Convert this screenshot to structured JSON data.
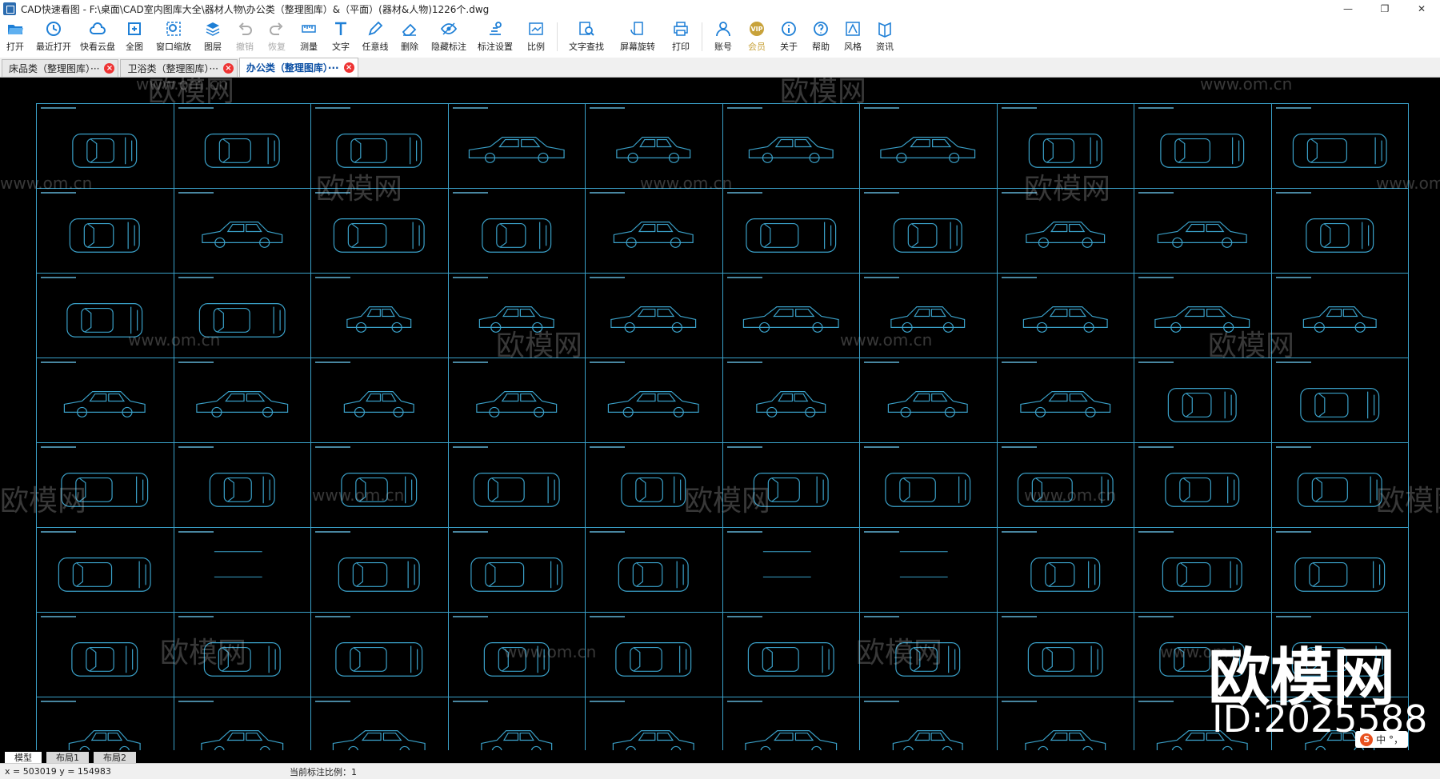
{
  "window": {
    "title": "CAD快速看图 - F:\\桌面\\CAD室内图库大全\\器材人物\\办公类（整理图库）&（平面）(器材&人物)1226个.dwg",
    "controls": {
      "minimize": "—",
      "maximize": "❐",
      "close": "✕"
    }
  },
  "toolbar": [
    {
      "key": "open",
      "label": "打开",
      "icon": "folder-open-icon",
      "color": "#1e7fd6"
    },
    {
      "key": "recent",
      "label": "最近打开",
      "icon": "clock-icon",
      "color": "#1e7fd6"
    },
    {
      "key": "cloud",
      "label": "快看云盘",
      "icon": "cloud-icon",
      "color": "#1e7fd6"
    },
    {
      "key": "fullview",
      "label": "全图",
      "icon": "fullview-icon",
      "color": "#1e7fd6"
    },
    {
      "key": "zoomwin",
      "label": "窗口缩放",
      "icon": "zoom-window-icon",
      "color": "#1e7fd6"
    },
    {
      "key": "layers",
      "label": "图层",
      "icon": "layers-icon",
      "color": "#1e7fd6"
    },
    {
      "key": "undo",
      "label": "撤销",
      "icon": "undo-icon",
      "color": "#aaaaaa",
      "disabled": true
    },
    {
      "key": "redo",
      "label": "恢复",
      "icon": "redo-icon",
      "color": "#aaaaaa",
      "disabled": true
    },
    {
      "key": "measure",
      "label": "测量",
      "icon": "ruler-icon",
      "color": "#1e7fd6"
    },
    {
      "key": "text",
      "label": "文字",
      "icon": "text-icon",
      "color": "#1e7fd6"
    },
    {
      "key": "freeline",
      "label": "任意线",
      "icon": "pen-icon",
      "color": "#1e7fd6"
    },
    {
      "key": "delete",
      "label": "删除",
      "icon": "eraser-icon",
      "color": "#1e7fd6"
    },
    {
      "key": "hidemark",
      "label": "隐藏标注",
      "icon": "eye-icon",
      "color": "#1e7fd6"
    },
    {
      "key": "marksettings",
      "label": "标注设置",
      "icon": "settings-icon",
      "color": "#1e7fd6"
    },
    {
      "key": "ratio",
      "label": "比例",
      "icon": "scale-icon",
      "color": "#1e7fd6"
    },
    {
      "key": "findtext",
      "label": "文字查找",
      "icon": "find-icon",
      "color": "#1e7fd6"
    },
    {
      "key": "rotate",
      "label": "屏幕旋转",
      "icon": "rotate-icon",
      "color": "#1e7fd6"
    },
    {
      "key": "print",
      "label": "打印",
      "icon": "printer-icon",
      "color": "#1e7fd6"
    },
    {
      "key": "account",
      "label": "账号",
      "icon": "user-icon",
      "color": "#1e7fd6"
    },
    {
      "key": "vip",
      "label": "会员",
      "icon": "vip-icon",
      "color": "#c8a23a",
      "vip": true
    },
    {
      "key": "about",
      "label": "关于",
      "icon": "info-icon",
      "color": "#1e7fd6"
    },
    {
      "key": "help",
      "label": "帮助",
      "icon": "help-icon",
      "color": "#1e7fd6"
    },
    {
      "key": "style",
      "label": "风格",
      "icon": "style-icon",
      "color": "#1e7fd6"
    },
    {
      "key": "news",
      "label": "资讯",
      "icon": "news-icon",
      "color": "#1e7fd6"
    }
  ],
  "tabs": [
    {
      "label": "床品类（整理图库）···",
      "active": false
    },
    {
      "label": "卫浴类（整理图库）···",
      "active": false
    },
    {
      "label": "办公类（整理图库）···",
      "active": true
    }
  ],
  "drawing": {
    "grid_rows": 8,
    "grid_cols": 10,
    "line_color": "#3aa0c8",
    "background": "#000000"
  },
  "watermark": {
    "text": "欧模网",
    "url": "www.om.cn",
    "big_text": "欧模网",
    "id_text": "ID:2025588"
  },
  "layout_tabs": [
    {
      "label": "模型",
      "active": true
    },
    {
      "label": "布局1",
      "active": false
    },
    {
      "label": "布局2",
      "active": false
    }
  ],
  "status": {
    "coords": "x = 503019  y = 154983",
    "scale": "当前标注比例：1"
  },
  "ime": {
    "logo": "S",
    "text": "中 °，"
  }
}
